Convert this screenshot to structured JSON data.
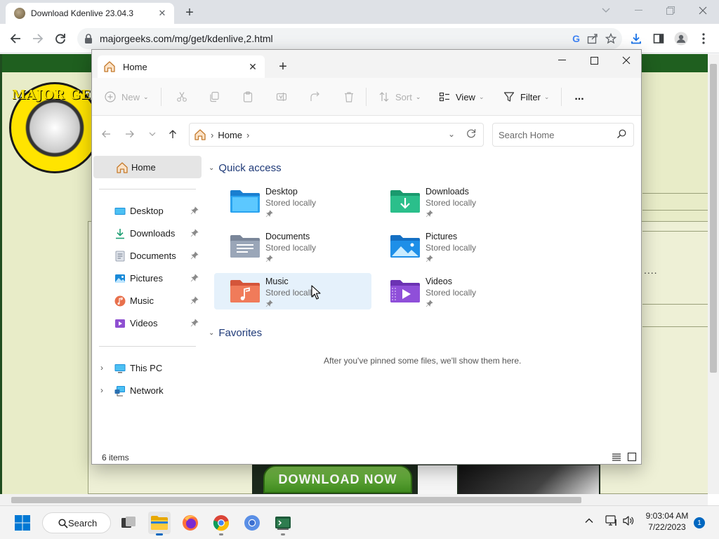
{
  "browser": {
    "tab_title": "Download Kdenlive 23.04.3",
    "url": "majorgeeks.com/mg/get/kdenlive,2.html"
  },
  "website": {
    "logo_text": "MAJOR GEE",
    "download_button": "DOWNLOAD NOW",
    "dots": "...."
  },
  "explorer": {
    "tab_label": "Home",
    "toolbar": {
      "new": "New",
      "sort": "Sort",
      "view": "View",
      "filter": "Filter",
      "more": "..."
    },
    "address": {
      "crumb": "Home",
      "search_placeholder": "Search Home"
    },
    "nav": {
      "home": "Home",
      "pinned": [
        {
          "label": "Desktop",
          "icon": "desktop-icon"
        },
        {
          "label": "Downloads",
          "icon": "downloads-icon"
        },
        {
          "label": "Documents",
          "icon": "documents-icon"
        },
        {
          "label": "Pictures",
          "icon": "pictures-icon"
        },
        {
          "label": "Music",
          "icon": "music-icon"
        },
        {
          "label": "Videos",
          "icon": "videos-icon"
        }
      ],
      "this_pc": "This PC",
      "network": "Network"
    },
    "quick_access": {
      "title": "Quick access",
      "items": [
        {
          "name": "Desktop",
          "status": "Stored locally"
        },
        {
          "name": "Downloads",
          "status": "Stored locally"
        },
        {
          "name": "Documents",
          "status": "Stored locally"
        },
        {
          "name": "Pictures",
          "status": "Stored locally"
        },
        {
          "name": "Music",
          "status": "Stored locally"
        },
        {
          "name": "Videos",
          "status": "Stored locally"
        }
      ]
    },
    "favorites": {
      "title": "Favorites",
      "empty_text": "After you've pinned some files, we'll show them here."
    },
    "status": {
      "count": "6 items"
    }
  },
  "taskbar": {
    "search_label": "Search",
    "time": "9:03:04 AM",
    "date": "7/22/2023",
    "notification_count": "1"
  },
  "colors": {
    "accent": "#0067c0",
    "site_bg": "#e8ecc8",
    "site_green": "#1f5f1f",
    "hover": "#e5f1fb"
  }
}
